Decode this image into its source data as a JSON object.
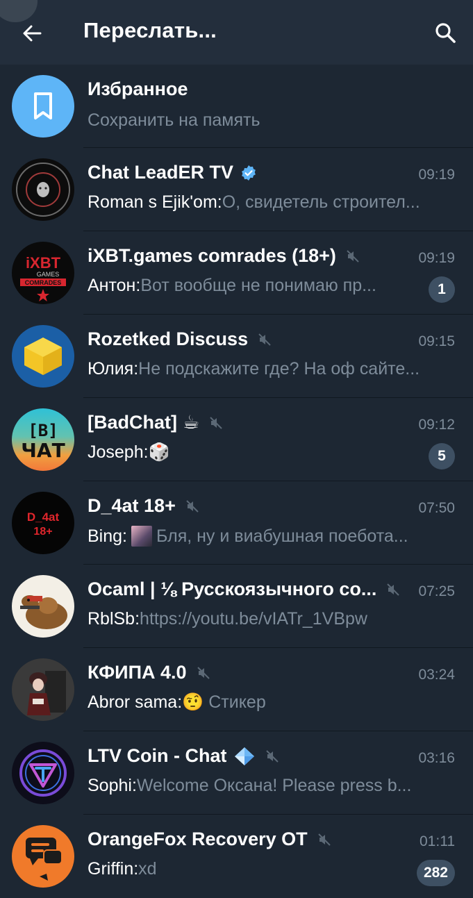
{
  "header": {
    "title": "Переслать...",
    "back_icon": "arrow-left-icon",
    "search_icon": "search-icon"
  },
  "saved": {
    "title": "Избранное",
    "subtitle": "Сохранить на память",
    "color": "#5eb5f7"
  },
  "chats": [
    {
      "name": "Chat LeadER TV",
      "time": "09:19",
      "sender": "Roman s Ejik'om:",
      "text": " О, свидетель строител...",
      "verified": true
    },
    {
      "name": "iXBT.games comrades (18+)",
      "time": "09:19",
      "sender": "Антон:",
      "text": " Вот вообще не понимаю пр...",
      "muted": true,
      "unread": "1"
    },
    {
      "name": "Rozetked Discuss",
      "time": "09:15",
      "sender": "Юлия:",
      "text": " Не подскажите где? На оф сайте...",
      "muted": true
    },
    {
      "name": "[BadChat]",
      "emoji": "☕",
      "time": "09:12",
      "sender": "Joseph:",
      "text": " 🎲",
      "muted": true,
      "unread": "5"
    },
    {
      "name": "D_4at 18+",
      "time": "07:50",
      "sender": "Bing:",
      "text": " Бля, ну и виабушная поебота...",
      "muted": true
    },
    {
      "name": "Ocaml | ⅛ Русскоязычного со...",
      "time": "07:25",
      "sender": "RblSb:",
      "text": " https://youtu.be/vIATr_1VBpw",
      "muted": true
    },
    {
      "name": "КФИПА 4.0",
      "time": "03:24",
      "sender": "Abror sama:",
      "text": " 🤨 Стикер",
      "muted": true
    },
    {
      "name": "LTV Coin - Chat",
      "time": "03:16",
      "sender": "Sophi:",
      "text": " Welcome Оксана! Please press b...",
      "muted": true,
      "gem": true
    },
    {
      "name": "OrangeFox Recovery OT",
      "time": "01:11",
      "sender": "Griffin:",
      "text": " xd",
      "muted": true,
      "unread": "282"
    }
  ],
  "avatars": {
    "ixbt_text": "iXBT",
    "ixbt_sub": "GAMES",
    "ixbt_sub2": "COMRADES",
    "badchat_text": "[B]",
    "badchat_text2": "ЧАТ",
    "d4at_text": "D_4at",
    "d4at_text2": "18+"
  },
  "colors": {
    "background": "#1d2733",
    "header": "#232e3c",
    "secondary_text": "#7e8c9a",
    "badge": "#3e5063",
    "accent": "#5eb5f7"
  }
}
